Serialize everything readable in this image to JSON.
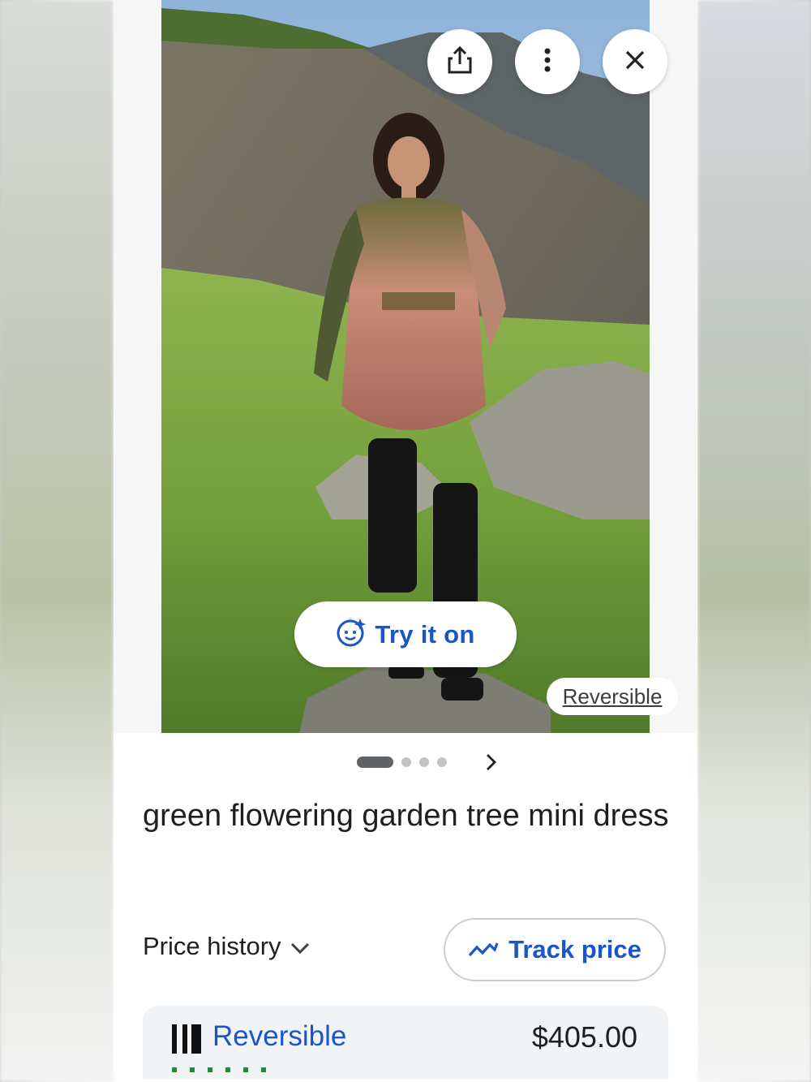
{
  "header_actions": {
    "share_icon": "share-icon",
    "more_icon": "more-vert-icon",
    "close_icon": "close-icon"
  },
  "image": {
    "try_on_label": "Try it on",
    "badge_label": "Reversible",
    "carousel": {
      "total": 4,
      "active": 1
    }
  },
  "product": {
    "title": "green flowering garden tree mini dress"
  },
  "price_history": {
    "label": "Price history"
  },
  "track_price": {
    "label": "Track price"
  },
  "offer": {
    "store": "Reversible",
    "price": "$405.00"
  },
  "colors": {
    "accent_blue": "#1a56c9",
    "text_dark": "#1f1f1f",
    "offer_bg": "#f1f4f7"
  }
}
